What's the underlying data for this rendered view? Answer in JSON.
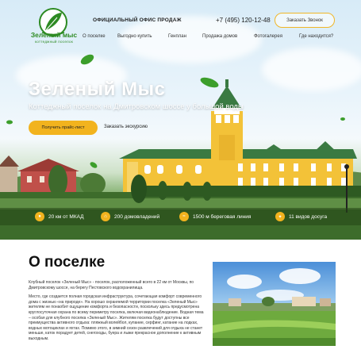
{
  "header": {
    "logo_title": "Зеленый мыс",
    "logo_subtitle": "коттеджный поселок",
    "office": "ОФИЦИАЛЬНЫЙ ОФИС ПРОДАЖ",
    "phone": "+7 (495) 120-12-48",
    "callback": "Заказать Звонок"
  },
  "nav": {
    "items": [
      "О поселке",
      "Выгодно купить",
      "Генплан",
      "Продажа домов",
      "Фотогалерея",
      "Где находится?"
    ]
  },
  "hero": {
    "title": "Зеленый Мыс",
    "subtitle": "Коттеджный поселок на Дмитровском шоссе у большой воды",
    "primary_button": "Получить прайс-лист",
    "secondary_link": "Заказать экскурсию"
  },
  "features": [
    {
      "icon": "map-pin-icon",
      "text": "20 км от МКАД"
    },
    {
      "icon": "house-icon",
      "text": "200 домовладений"
    },
    {
      "icon": "wave-icon",
      "text": "1500 м береговая линия"
    },
    {
      "icon": "leisure-icon",
      "text": "11 видов досуга"
    }
  ],
  "about": {
    "title": "О поселке",
    "paragraphs": [
      "Клубный поселок «Зеленый Мыс» - поселок, расположенный всего в 22 км от Москвы, по Дмитровскому шоссе, на берегу Пестовского водохранилища.",
      "Место, где создается полная городская инфраструктура, сочетающая комфорт современного дома с жизнью «на природе». На хорошо охраняемой территории поселка «Зеленый Мыс» жителям не понаобит ощущение комфорта и безопасности, поскольку здесь предусмотрена круглосуточная охрана по всему периметру поселка, включая видеонаблюдение. Водная тема – особая для клубного поселка «Зеленый Мыс». Жителям поселка будут доступны все преимущества активного отдыха: пляжный волейбол, купание, серфинг, катание на лодках, водных мотоциклах и яхтах. Помимо этого, в зимний сезон развлечений для отдыха не станет меньше, каток порадует детей, снегоходы, буера и лыжи прекрасное дополнение к активным выходным."
    ]
  },
  "colors": {
    "accent": "#f2b31e",
    "brand_green": "#2d8a22"
  }
}
